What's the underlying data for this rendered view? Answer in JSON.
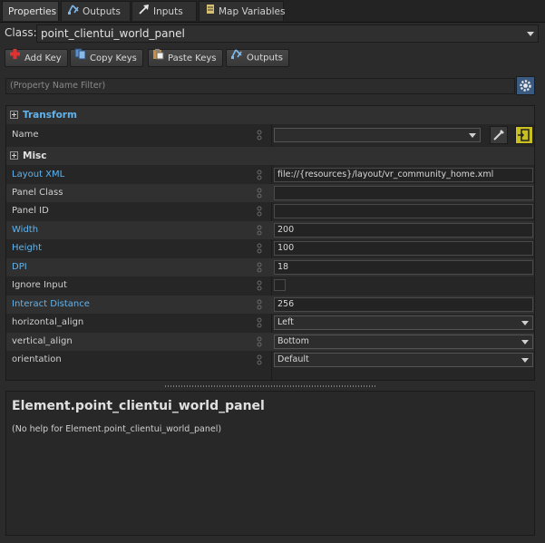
{
  "tabs": [
    {
      "label": "Properties",
      "icon": "none",
      "active": true
    },
    {
      "label": "Outputs",
      "icon": "outputs-icon",
      "active": false
    },
    {
      "label": "Inputs",
      "icon": "inputs-icon",
      "active": false
    },
    {
      "label": "Map Variables",
      "icon": "map-variables-icon",
      "active": false
    }
  ],
  "class_row": {
    "label": "Class:",
    "value": "point_clientui_world_panel"
  },
  "toolbar": {
    "add_key": "Add Key",
    "copy_keys": "Copy Keys",
    "paste_keys": "Paste Keys",
    "outputs": "Outputs"
  },
  "filter": {
    "placeholder": "(Property Name Filter)"
  },
  "groups": {
    "transform": "Transform",
    "misc": "Misc"
  },
  "properties": {
    "name": {
      "label": "Name",
      "value": ""
    },
    "layout_xml": {
      "label": "Layout XML",
      "value": "file://{resources}/layout/vr_community_home.xml"
    },
    "panel_class": {
      "label": "Panel Class",
      "value": ""
    },
    "panel_id": {
      "label": "Panel ID",
      "value": ""
    },
    "width": {
      "label": "Width",
      "value": "200"
    },
    "height": {
      "label": "Height",
      "value": "100"
    },
    "dpi": {
      "label": "DPI",
      "value": "18"
    },
    "ignore_input": {
      "label": "Ignore Input",
      "checked": false
    },
    "interact_distance": {
      "label": "Interact Distance",
      "value": "256"
    },
    "horizontal_align": {
      "label": "horizontal_align",
      "value": "Left"
    },
    "vertical_align": {
      "label": "vertical_align",
      "value": "Bottom"
    },
    "orientation": {
      "label": "orientation",
      "value": "Default"
    }
  },
  "help": {
    "title": "Element.point_clientui_world_panel",
    "body": "(No help for Element.point_clientui_world_panel)"
  },
  "colors": {
    "modified_label": "#5fb4f0",
    "background": "#2b2b2b"
  }
}
